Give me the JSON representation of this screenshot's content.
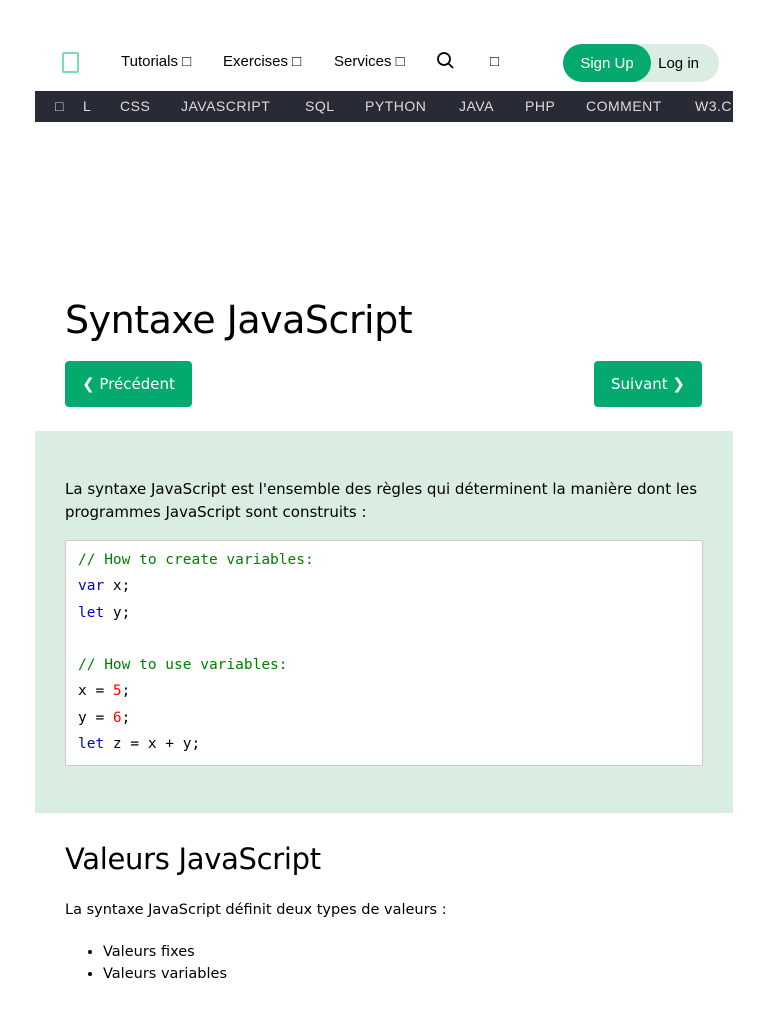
{
  "nav": {
    "tutorials": "Tutorials □",
    "exercises": "Exercises □",
    "services": "Services □",
    "extra_icon": "□",
    "sign_up": "Sign Up",
    "log_in": "Log in"
  },
  "topics": [
    "□",
    "L",
    "CSS",
    "JAVASCRIPT",
    "SQL",
    "PYTHON",
    "JAVA",
    "PHP",
    "COMMENT",
    "W3.C"
  ],
  "page": {
    "title": "Syntaxe JavaScript",
    "prev": "❮ Précédent",
    "next": "Suivant ❯"
  },
  "example": {
    "intro": "La syntaxe JavaScript est l'ensemble des règles qui déterminent la manière dont les programmes JavaScript sont construits :",
    "c1": "// How to create variables:",
    "kw_var": "var",
    "l2": " x;",
    "kw_let": "let",
    "l3": " y;",
    "c2": "// How to use variables:",
    "l5a": "x = ",
    "n5": "5",
    "semi": ";",
    "l6a": "y = ",
    "n6": "6",
    "l7": " z = x + y;"
  },
  "values": {
    "heading": "Valeurs JavaScript",
    "text": "La syntaxe JavaScript définit deux types de valeurs :",
    "items": [
      "Valeurs fixes",
      "Valeurs variables"
    ]
  },
  "colors": {
    "accent": "#04aa6d",
    "panel": "#d9eee1",
    "bar": "#282a35"
  }
}
